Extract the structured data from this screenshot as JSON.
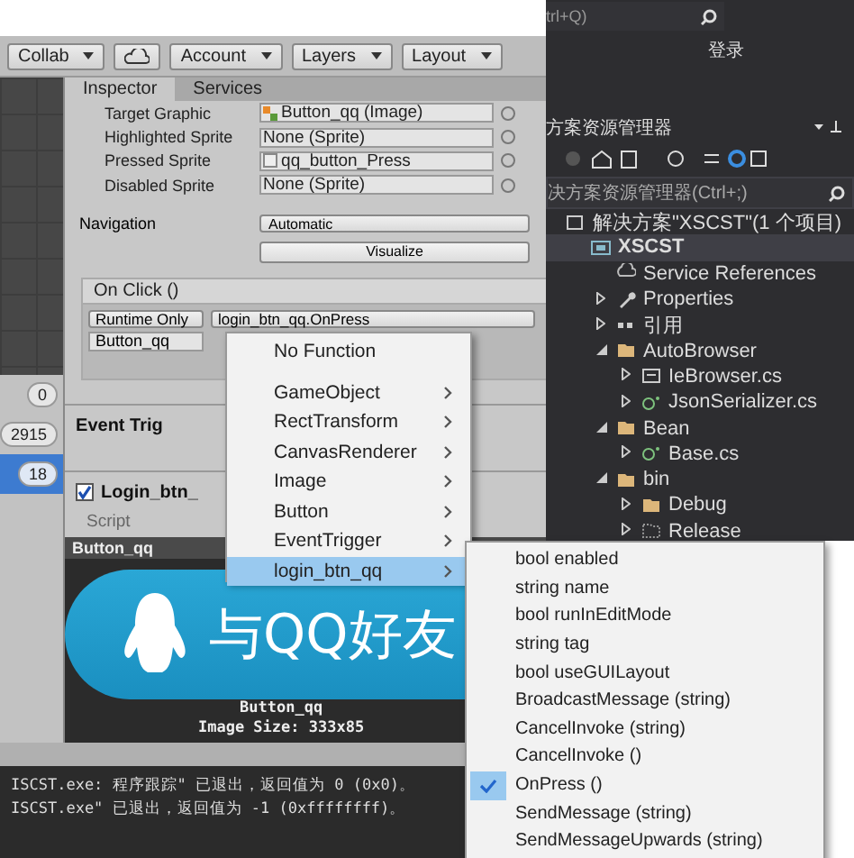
{
  "unity": {
    "toolbar": [
      {
        "kind": "dropdown",
        "label": "Collab"
      },
      {
        "kind": "cloud"
      },
      {
        "kind": "dropdown",
        "label": "Account"
      },
      {
        "kind": "dropdown",
        "label": "Layers"
      },
      {
        "kind": "dropdown",
        "label": "Layout"
      }
    ],
    "tabs": [
      {
        "label": "Inspector",
        "selected": true
      },
      {
        "label": "Services",
        "selected": false
      }
    ],
    "hierarchy_badges": [
      {
        "label": "0",
        "selected": false
      },
      {
        "label": "2915",
        "selected": false
      },
      {
        "label": "18",
        "selected": true
      }
    ],
    "sprite_fields": [
      {
        "label": "Target Graphic",
        "value": "Button_qq (Image)",
        "kind": "image"
      },
      {
        "label": "Highlighted Sprite",
        "value": "None (Sprite)",
        "kind": "none"
      },
      {
        "label": "Pressed Sprite",
        "value": "qq_button_Press",
        "kind": "sprite"
      },
      {
        "label": "Disabled Sprite",
        "value": "None (Sprite)",
        "kind": "none"
      }
    ],
    "navigation": {
      "label": "Navigation",
      "value": "Automatic"
    },
    "visualize": "Visualize",
    "on_click": {
      "title": "On Click ()",
      "mode": "Runtime Only",
      "function": "login_btn_qq.OnPress",
      "target": "Button_qq"
    },
    "components": [
      {
        "title": "Event Trig",
        "kind": "trigger"
      },
      {
        "title": "Login_btn_",
        "kind": "script",
        "enabled": true,
        "script_label": "Script"
      }
    ],
    "preview": {
      "title": "Button_qq",
      "image_text": "与QQ好友",
      "name": "Button_qq",
      "size": "Image Size: 333x85"
    }
  },
  "output": {
    "lines": [
      "ISCST.exe: 程序跟踪\" 已退出，返回值为 0 (0x0)。",
      "ISCST.exe\" 已退出，返回值为 -1 (0xffffffff)。"
    ]
  },
  "vs": {
    "search_hint": "trl+Q)",
    "login": "登录",
    "panel_title": "方案资源管理器",
    "search": {
      "placeholder": "决方案资源管理器(Ctrl+;)"
    },
    "tree": [
      {
        "label": "解决方案\"XSCST\"(1 个项目)",
        "kind": "solution",
        "selected": false,
        "children": [
          {
            "label": "XSCST",
            "kind": "project",
            "selected": true,
            "children": [
              {
                "label": "Service References",
                "kind": "service",
                "selected": false
              },
              {
                "label": "Properties",
                "kind": "wrench",
                "selected": false,
                "expanded": false
              },
              {
                "label": "引用",
                "kind": "refs",
                "selected": false,
                "expanded": false
              },
              {
                "label": "AutoBrowser",
                "kind": "folder",
                "selected": false,
                "expanded": true,
                "children": [
                  {
                    "label": "IeBrowser.cs",
                    "kind": "form",
                    "selected": false,
                    "expanded": false
                  },
                  {
                    "label": "JsonSerializer.cs",
                    "kind": "cs",
                    "selected": false,
                    "expanded": false
                  }
                ]
              },
              {
                "label": "Bean",
                "kind": "folder",
                "selected": false,
                "expanded": true,
                "children": [
                  {
                    "label": "Base.cs",
                    "kind": "cs",
                    "selected": false,
                    "expanded": false
                  }
                ]
              },
              {
                "label": "bin",
                "kind": "folder",
                "selected": false,
                "expanded": true,
                "children": [
                  {
                    "label": "Debug",
                    "kind": "folder",
                    "selected": false,
                    "expanded": false
                  },
                  {
                    "label": "Release",
                    "kind": "hidden-folder",
                    "selected": false,
                    "expanded": false
                  }
                ]
              }
            ]
          }
        ]
      }
    ]
  },
  "menu": {
    "items": [
      {
        "label": "No Function",
        "submenu": false,
        "selected": false
      },
      {
        "label": "GameObject",
        "submenu": true,
        "selected": false
      },
      {
        "label": "RectTransform",
        "submenu": true,
        "selected": false
      },
      {
        "label": "CanvasRenderer",
        "submenu": true,
        "selected": false
      },
      {
        "label": "Image",
        "submenu": true,
        "selected": false
      },
      {
        "label": "Button",
        "submenu": true,
        "selected": false
      },
      {
        "label": "EventTrigger",
        "submenu": true,
        "selected": false
      },
      {
        "label": "login_btn_qq",
        "submenu": true,
        "selected": true
      }
    ]
  },
  "submenu": {
    "items": [
      {
        "label": "bool enabled",
        "checked": false
      },
      {
        "label": "string name",
        "checked": false
      },
      {
        "label": "bool runInEditMode",
        "checked": false
      },
      {
        "label": "string tag",
        "checked": false
      },
      {
        "label": "bool useGUILayout",
        "checked": false
      },
      {
        "label": "BroadcastMessage (string)",
        "checked": false
      },
      {
        "label": "CancelInvoke (string)",
        "checked": false
      },
      {
        "label": "CancelInvoke ()",
        "checked": false
      },
      {
        "label": "OnPress ()",
        "checked": true
      },
      {
        "label": "SendMessage (string)",
        "checked": false
      },
      {
        "label": "SendMessageUpwards (string)",
        "checked": false
      }
    ]
  }
}
